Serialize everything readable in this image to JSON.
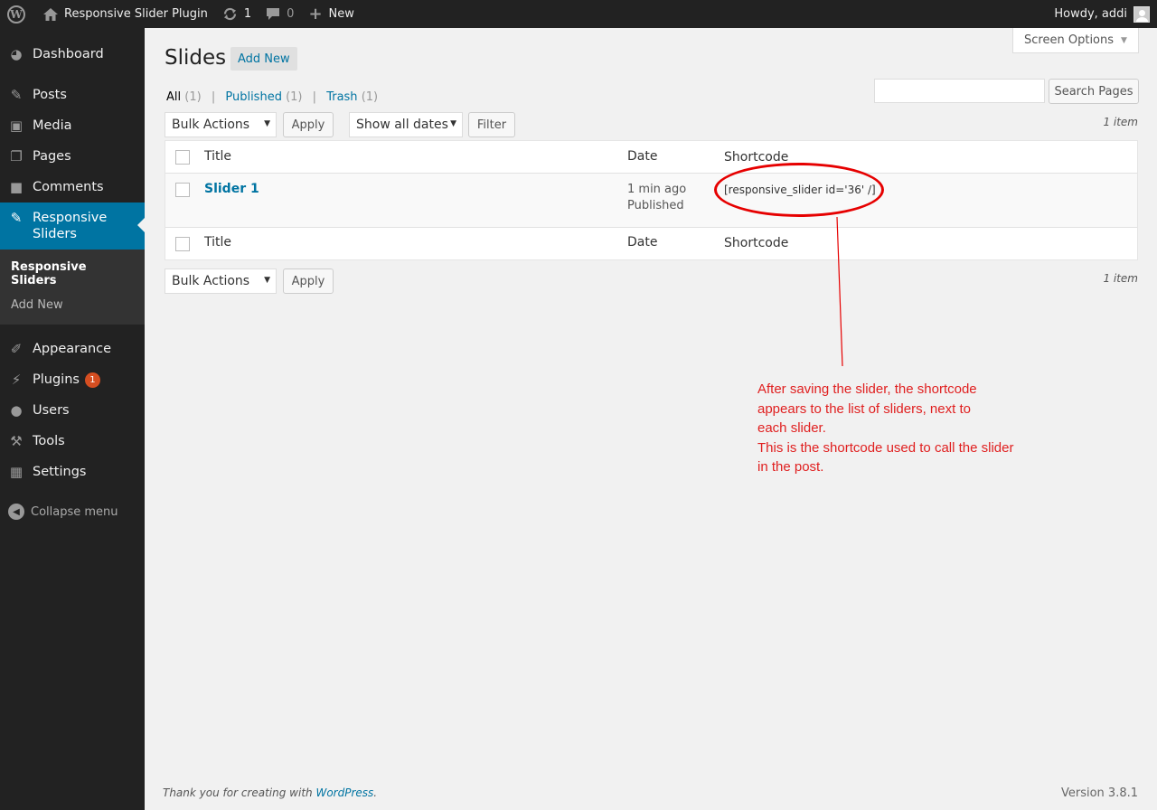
{
  "adminbar": {
    "site_name": "Responsive Slider Plugin",
    "updates_count": "1",
    "comments_count": "0",
    "new_label": "New",
    "howdy": "Howdy, addi",
    "icons": {
      "logo": "wordpress-logo-icon",
      "home": "home-icon",
      "updates": "updates-icon",
      "comments": "comment-bubble-icon",
      "new": "plus-icon"
    }
  },
  "sidebar": {
    "items": [
      {
        "label": "Dashboard",
        "icon": "dashboard-icon"
      },
      {
        "label": "Posts",
        "icon": "pushpin-icon"
      },
      {
        "label": "Media",
        "icon": "media-icon"
      },
      {
        "label": "Pages",
        "icon": "pages-icon"
      },
      {
        "label": "Comments",
        "icon": "comment-icon"
      },
      {
        "label": "Responsive Sliders",
        "icon": "pushpin-icon",
        "active": true
      },
      {
        "label": "Appearance",
        "icon": "brush-icon"
      },
      {
        "label": "Plugins",
        "icon": "plugin-icon",
        "badge": "1"
      },
      {
        "label": "Users",
        "icon": "users-icon"
      },
      {
        "label": "Tools",
        "icon": "wrench-icon"
      },
      {
        "label": "Settings",
        "icon": "settings-icon"
      }
    ],
    "submenu": [
      "Responsive Sliders",
      "Add New"
    ],
    "collapse_label": "Collapse menu"
  },
  "header": {
    "screen_options": "Screen Options",
    "title": "Slides",
    "add_new": "Add New"
  },
  "filters": {
    "all": "All",
    "all_count": "(1)",
    "published": "Published",
    "published_count": "(1)",
    "trash": "Trash",
    "trash_count": "(1)",
    "separator": "|"
  },
  "search": {
    "value": "",
    "button": "Search Pages"
  },
  "tablenav": {
    "bulk_actions": "Bulk Actions",
    "apply": "Apply",
    "dates": "Show all dates",
    "filter": "Filter",
    "items_count": "1 item"
  },
  "table": {
    "columns": [
      "Title",
      "Date",
      "Shortcode"
    ],
    "rows": [
      {
        "title": "Slider 1",
        "date": "1 min ago",
        "status": "Published",
        "shortcode": "[responsive_slider id='36' /]"
      }
    ]
  },
  "annotation": {
    "color": "#e60000",
    "text": "After saving the slider, the shortcode\nappears to the list of sliders, next to\neach slider.\nThis is the shortcode used to call the slider\nin the post."
  },
  "footer": {
    "thanks": "Thank you for creating with ",
    "link": "WordPress",
    "period": ".",
    "version": "Version 3.8.1"
  },
  "colors": {
    "accent": "#0074a2",
    "adminbar": "#222222",
    "badge": "#d54e21"
  }
}
